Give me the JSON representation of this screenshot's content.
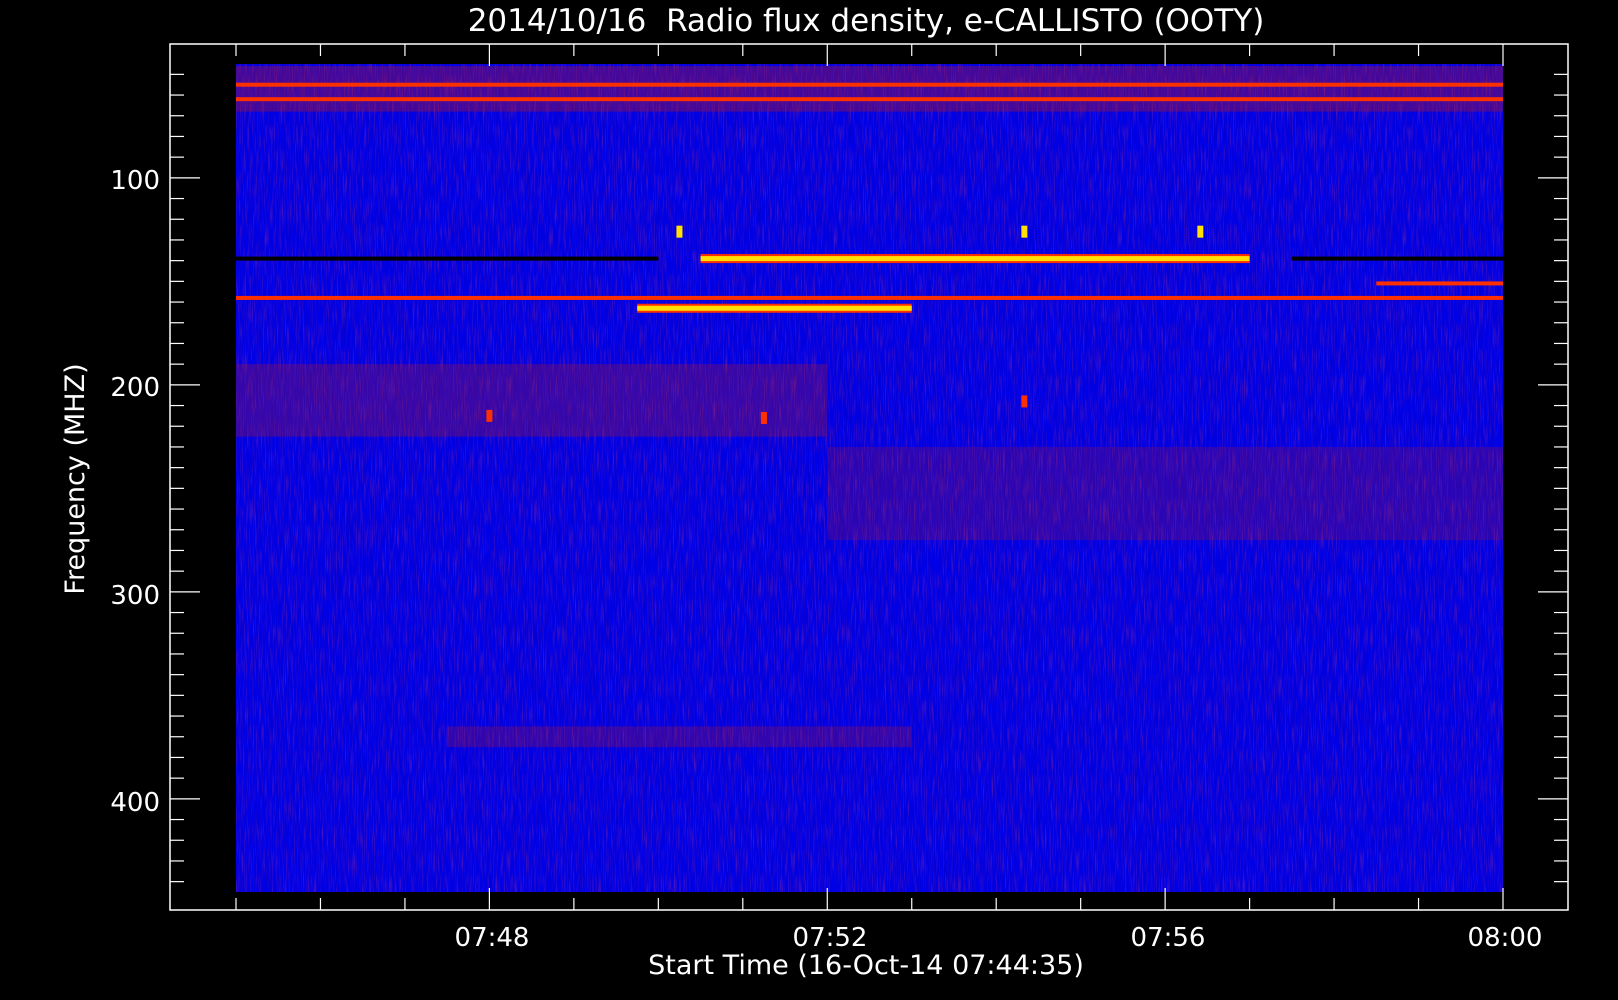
{
  "chart_data": {
    "type": "heatmap",
    "title": "2014/10/16  Radio flux density, e-CALLISTO (OOTY)",
    "xlabel": "Start Time (16-Oct-14 07:44:35)",
    "ylabel": "Frequency (MHZ)",
    "x_tick_labels": [
      "07:48",
      "07:52",
      "07:56",
      "08:00"
    ],
    "y_tick_labels": [
      "100",
      "200",
      "300",
      "400"
    ],
    "x_range_minutes": [
      "07:45",
      "08:00"
    ],
    "y_range_mhz": [
      45,
      445
    ],
    "y_inverted": true,
    "colormap": [
      "#000000",
      "#0000e6",
      "#2020ff",
      "#c01818",
      "#ff3000",
      "#ffe000"
    ],
    "features": [
      {
        "kind": "horizontal-band",
        "freq_mhz": 139,
        "start": "07:45",
        "end": "07:50",
        "intensity": "low"
      },
      {
        "kind": "horizontal-band",
        "freq_mhz": 139,
        "start": "07:50:30",
        "end": "07:57",
        "intensity": "high"
      },
      {
        "kind": "horizontal-band",
        "freq_mhz": 139,
        "start": "07:57:30",
        "end": "08:00",
        "intensity": "low"
      },
      {
        "kind": "horizontal-band",
        "freq_mhz": 158,
        "start": "07:45",
        "end": "08:00",
        "intensity": "medium"
      },
      {
        "kind": "horizontal-band",
        "freq_mhz": 163,
        "start": "07:49:45",
        "end": "07:53",
        "intensity": "high"
      },
      {
        "kind": "horizontal-band",
        "freq_mhz": 151,
        "start": "07:58:30",
        "end": "08:00",
        "intensity": "medium"
      },
      {
        "kind": "horizontal-band",
        "freq_mhz": 55,
        "start": "07:45",
        "end": "08:00",
        "intensity": "medium"
      },
      {
        "kind": "horizontal-band",
        "freq_mhz": 62,
        "start": "07:45",
        "end": "08:00",
        "intensity": "medium"
      },
      {
        "kind": "spot",
        "freq_mhz": 215,
        "time": "07:48",
        "intensity": "medium"
      },
      {
        "kind": "spot",
        "freq_mhz": 216,
        "time": "07:51:15",
        "intensity": "medium"
      },
      {
        "kind": "spot",
        "freq_mhz": 208,
        "time": "07:54:20",
        "intensity": "medium"
      },
      {
        "kind": "spot",
        "freq_mhz": 126,
        "time": "07:50:15",
        "intensity": "high"
      },
      {
        "kind": "spot",
        "freq_mhz": 126,
        "time": "07:54:20",
        "intensity": "high"
      },
      {
        "kind": "spot",
        "freq_mhz": 126,
        "time": "07:56:25",
        "intensity": "high"
      }
    ]
  }
}
